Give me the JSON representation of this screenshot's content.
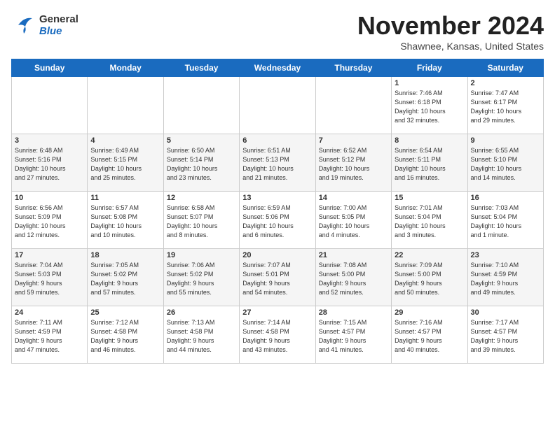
{
  "header": {
    "logo_general": "General",
    "logo_blue": "Blue",
    "month": "November 2024",
    "location": "Shawnee, Kansas, United States"
  },
  "days_of_week": [
    "Sunday",
    "Monday",
    "Tuesday",
    "Wednesday",
    "Thursday",
    "Friday",
    "Saturday"
  ],
  "weeks": [
    [
      {
        "day": "",
        "info": ""
      },
      {
        "day": "",
        "info": ""
      },
      {
        "day": "",
        "info": ""
      },
      {
        "day": "",
        "info": ""
      },
      {
        "day": "",
        "info": ""
      },
      {
        "day": "1",
        "info": "Sunrise: 7:46 AM\nSunset: 6:18 PM\nDaylight: 10 hours\nand 32 minutes."
      },
      {
        "day": "2",
        "info": "Sunrise: 7:47 AM\nSunset: 6:17 PM\nDaylight: 10 hours\nand 29 minutes."
      }
    ],
    [
      {
        "day": "3",
        "info": "Sunrise: 6:48 AM\nSunset: 5:16 PM\nDaylight: 10 hours\nand 27 minutes."
      },
      {
        "day": "4",
        "info": "Sunrise: 6:49 AM\nSunset: 5:15 PM\nDaylight: 10 hours\nand 25 minutes."
      },
      {
        "day": "5",
        "info": "Sunrise: 6:50 AM\nSunset: 5:14 PM\nDaylight: 10 hours\nand 23 minutes."
      },
      {
        "day": "6",
        "info": "Sunrise: 6:51 AM\nSunset: 5:13 PM\nDaylight: 10 hours\nand 21 minutes."
      },
      {
        "day": "7",
        "info": "Sunrise: 6:52 AM\nSunset: 5:12 PM\nDaylight: 10 hours\nand 19 minutes."
      },
      {
        "day": "8",
        "info": "Sunrise: 6:54 AM\nSunset: 5:11 PM\nDaylight: 10 hours\nand 16 minutes."
      },
      {
        "day": "9",
        "info": "Sunrise: 6:55 AM\nSunset: 5:10 PM\nDaylight: 10 hours\nand 14 minutes."
      }
    ],
    [
      {
        "day": "10",
        "info": "Sunrise: 6:56 AM\nSunset: 5:09 PM\nDaylight: 10 hours\nand 12 minutes."
      },
      {
        "day": "11",
        "info": "Sunrise: 6:57 AM\nSunset: 5:08 PM\nDaylight: 10 hours\nand 10 minutes."
      },
      {
        "day": "12",
        "info": "Sunrise: 6:58 AM\nSunset: 5:07 PM\nDaylight: 10 hours\nand 8 minutes."
      },
      {
        "day": "13",
        "info": "Sunrise: 6:59 AM\nSunset: 5:06 PM\nDaylight: 10 hours\nand 6 minutes."
      },
      {
        "day": "14",
        "info": "Sunrise: 7:00 AM\nSunset: 5:05 PM\nDaylight: 10 hours\nand 4 minutes."
      },
      {
        "day": "15",
        "info": "Sunrise: 7:01 AM\nSunset: 5:04 PM\nDaylight: 10 hours\nand 3 minutes."
      },
      {
        "day": "16",
        "info": "Sunrise: 7:03 AM\nSunset: 5:04 PM\nDaylight: 10 hours\nand 1 minute."
      }
    ],
    [
      {
        "day": "17",
        "info": "Sunrise: 7:04 AM\nSunset: 5:03 PM\nDaylight: 9 hours\nand 59 minutes."
      },
      {
        "day": "18",
        "info": "Sunrise: 7:05 AM\nSunset: 5:02 PM\nDaylight: 9 hours\nand 57 minutes."
      },
      {
        "day": "19",
        "info": "Sunrise: 7:06 AM\nSunset: 5:02 PM\nDaylight: 9 hours\nand 55 minutes."
      },
      {
        "day": "20",
        "info": "Sunrise: 7:07 AM\nSunset: 5:01 PM\nDaylight: 9 hours\nand 54 minutes."
      },
      {
        "day": "21",
        "info": "Sunrise: 7:08 AM\nSunset: 5:00 PM\nDaylight: 9 hours\nand 52 minutes."
      },
      {
        "day": "22",
        "info": "Sunrise: 7:09 AM\nSunset: 5:00 PM\nDaylight: 9 hours\nand 50 minutes."
      },
      {
        "day": "23",
        "info": "Sunrise: 7:10 AM\nSunset: 4:59 PM\nDaylight: 9 hours\nand 49 minutes."
      }
    ],
    [
      {
        "day": "24",
        "info": "Sunrise: 7:11 AM\nSunset: 4:59 PM\nDaylight: 9 hours\nand 47 minutes."
      },
      {
        "day": "25",
        "info": "Sunrise: 7:12 AM\nSunset: 4:58 PM\nDaylight: 9 hours\nand 46 minutes."
      },
      {
        "day": "26",
        "info": "Sunrise: 7:13 AM\nSunset: 4:58 PM\nDaylight: 9 hours\nand 44 minutes."
      },
      {
        "day": "27",
        "info": "Sunrise: 7:14 AM\nSunset: 4:58 PM\nDaylight: 9 hours\nand 43 minutes."
      },
      {
        "day": "28",
        "info": "Sunrise: 7:15 AM\nSunset: 4:57 PM\nDaylight: 9 hours\nand 41 minutes."
      },
      {
        "day": "29",
        "info": "Sunrise: 7:16 AM\nSunset: 4:57 PM\nDaylight: 9 hours\nand 40 minutes."
      },
      {
        "day": "30",
        "info": "Sunrise: 7:17 AM\nSunset: 4:57 PM\nDaylight: 9 hours\nand 39 minutes."
      }
    ]
  ]
}
